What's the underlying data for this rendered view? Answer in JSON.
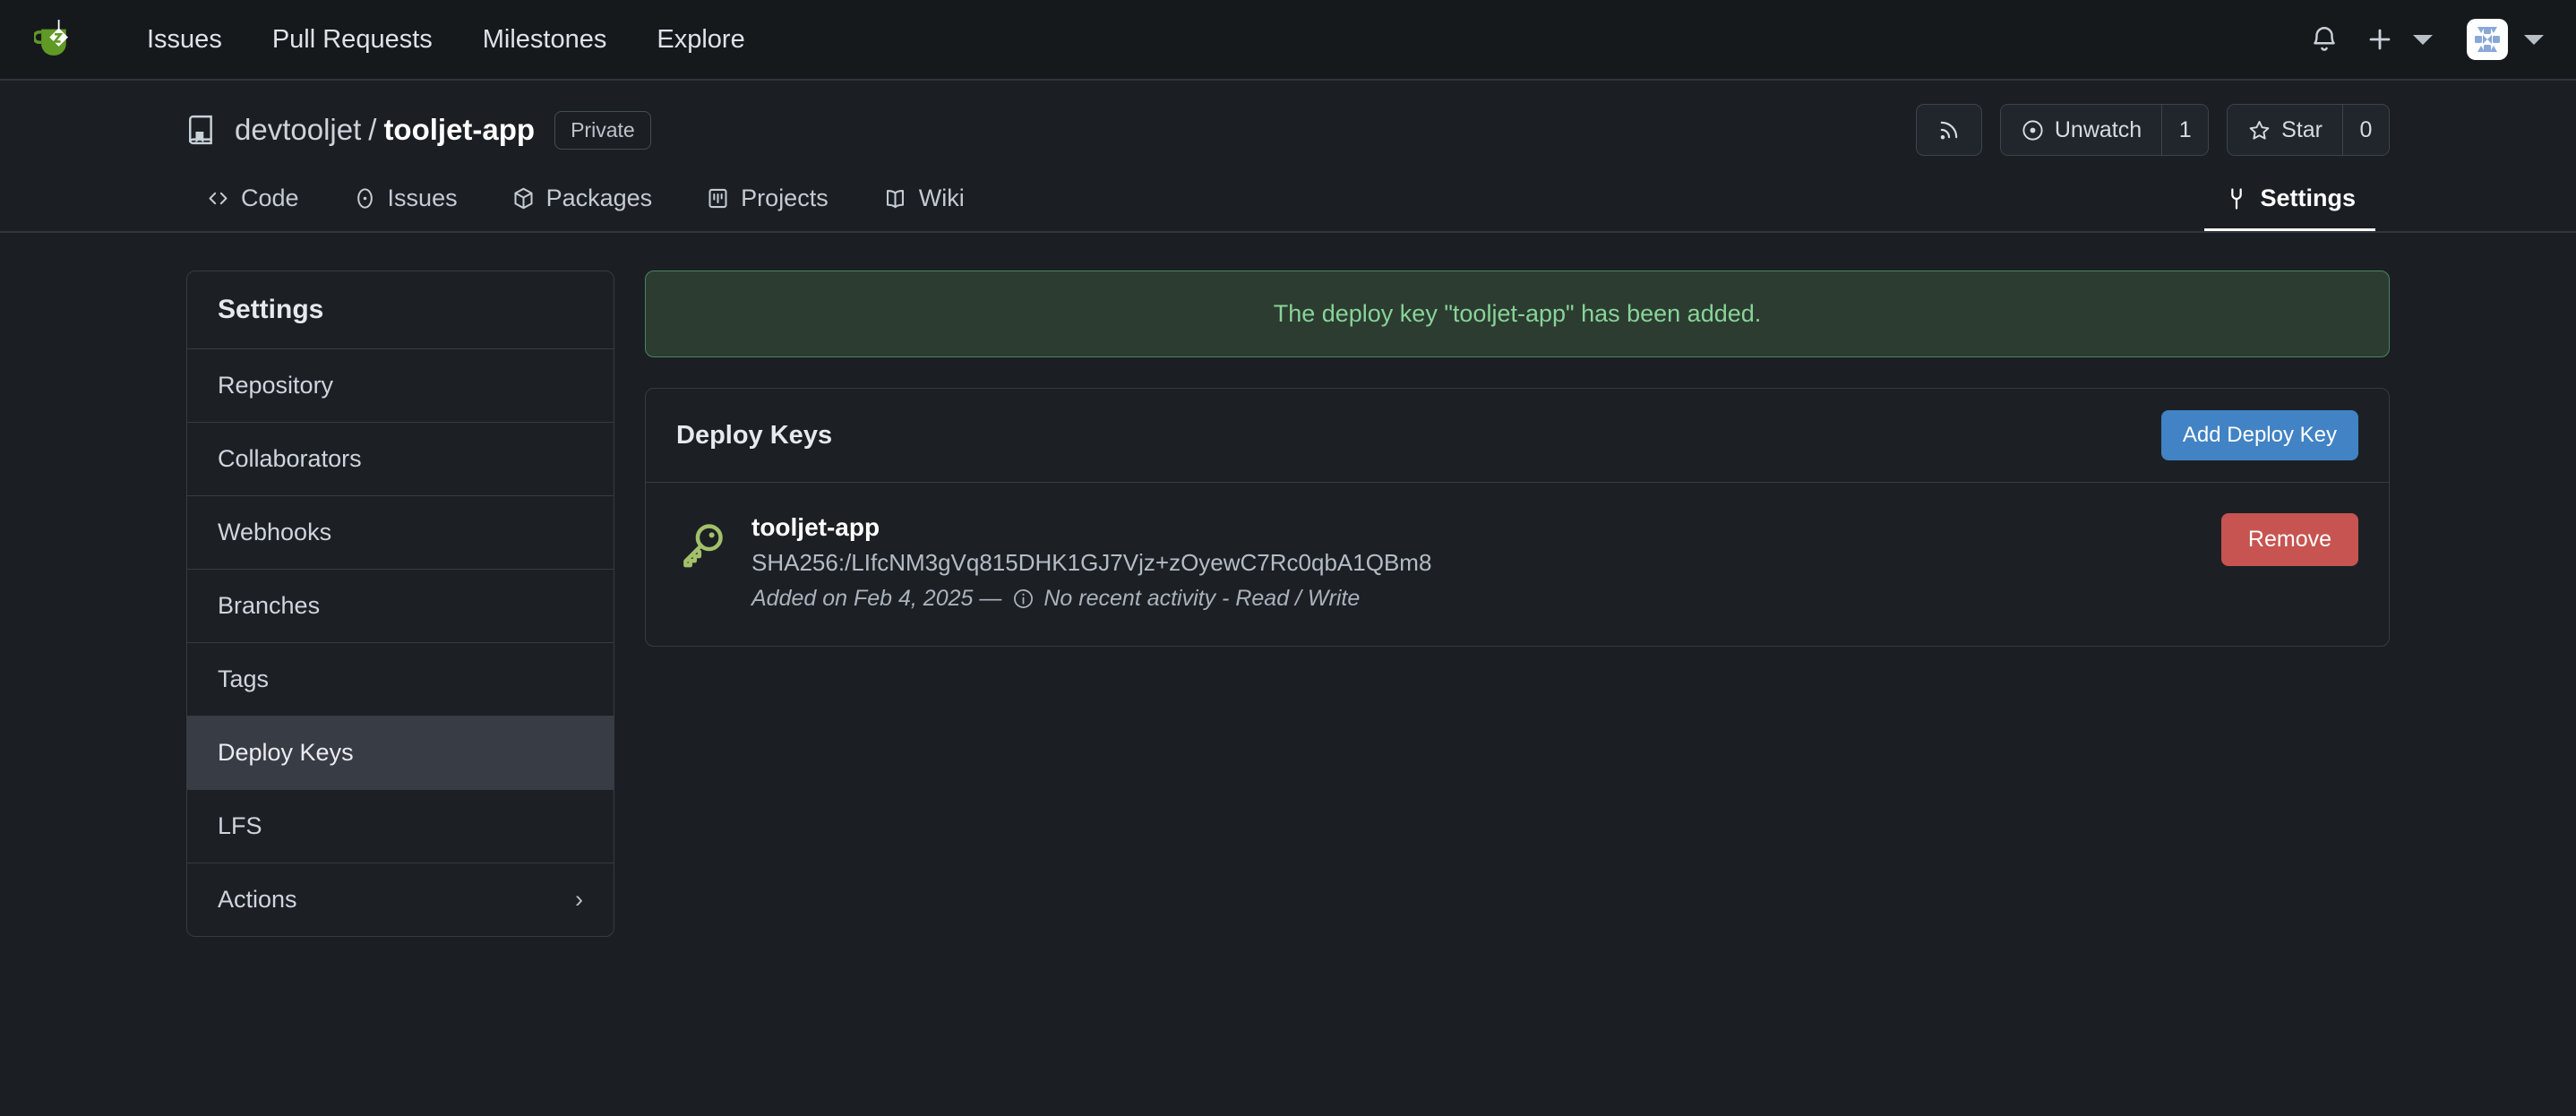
{
  "navbar": {
    "logo_name": "gitea-logo",
    "links": [
      {
        "label": "Issues"
      },
      {
        "label": "Pull Requests"
      },
      {
        "label": "Milestones"
      },
      {
        "label": "Explore"
      }
    ],
    "notification_icon": "bell-icon",
    "create_icon": "plus-icon",
    "avatar_name": "user-avatar"
  },
  "repo": {
    "owner": "devtooljet",
    "separator": "/",
    "name": "tooljet-app",
    "visibility": "Private",
    "rss_icon": "rss-icon",
    "watch_label": "Unwatch",
    "watch_count": "1",
    "star_label": "Star",
    "star_count": "0",
    "tabs": [
      {
        "label": "Code",
        "icon": "code-icon",
        "active": false
      },
      {
        "label": "Issues",
        "icon": "issue-icon",
        "active": false
      },
      {
        "label": "Packages",
        "icon": "package-icon",
        "active": false
      },
      {
        "label": "Projects",
        "icon": "project-icon",
        "active": false
      },
      {
        "label": "Wiki",
        "icon": "wiki-icon",
        "active": false
      },
      {
        "label": "Settings",
        "icon": "wrench-icon",
        "active": true
      }
    ]
  },
  "sidebar": {
    "heading": "Settings",
    "items": [
      {
        "label": "Repository",
        "active": false,
        "chevron": ""
      },
      {
        "label": "Collaborators",
        "active": false,
        "chevron": ""
      },
      {
        "label": "Webhooks",
        "active": false,
        "chevron": ""
      },
      {
        "label": "Branches",
        "active": false,
        "chevron": ""
      },
      {
        "label": "Tags",
        "active": false,
        "chevron": ""
      },
      {
        "label": "Deploy Keys",
        "active": true,
        "chevron": ""
      },
      {
        "label": "LFS",
        "active": false,
        "chevron": ""
      },
      {
        "label": "Actions",
        "active": false,
        "chevron": "›"
      }
    ]
  },
  "flash": {
    "message": "The deploy key \"tooljet-app\" has been added.",
    "color": "#88d498",
    "background": "#2c3c31",
    "border": "#4d8460"
  },
  "panel": {
    "title": "Deploy Keys",
    "add_button": "Add Deploy Key",
    "add_button_color": "#4183c4",
    "keys": [
      {
        "name": "tooljet-app",
        "fingerprint": "SHA256:/LIfcNM3gVq815DHK1GJ7Vjz+zOyewC7Rc0qbA1QBm8",
        "added_text": "Added on Feb 4, 2025 —",
        "activity_text": "No recent activity - Read / Write",
        "remove_button": "Remove",
        "remove_button_color": "#c75450",
        "key_icon_color": "#a3c06b"
      }
    ]
  }
}
